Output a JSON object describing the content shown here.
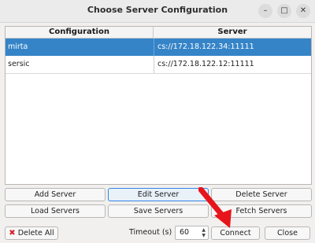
{
  "window": {
    "title": "Choose Server Configuration",
    "controls": {
      "minimize": "–",
      "maximize": "□",
      "close": "✕"
    }
  },
  "table": {
    "headers": [
      "Configuration",
      "Server"
    ],
    "rows": [
      {
        "configuration": "mirta",
        "server": "cs://172.18.122.34:11111",
        "selected": true
      },
      {
        "configuration": "sersic",
        "server": "cs://172.18.122.12:11111",
        "selected": false
      }
    ],
    "selection_color": "#3584c8"
  },
  "buttons": {
    "add_server": "Add Server",
    "edit_server": "Edit Server",
    "delete_server": "Delete Server",
    "load_servers": "Load Servers",
    "save_servers": "Save Servers",
    "fetch_servers": "Fetch Servers",
    "delete_all": "Delete All",
    "connect": "Connect",
    "close": "Close"
  },
  "timeout": {
    "label": "Timeout (s)",
    "value": "60"
  },
  "annotation": {
    "icon": "red-arrow-icon",
    "color": "#e8141b",
    "points_to": "Connect"
  }
}
